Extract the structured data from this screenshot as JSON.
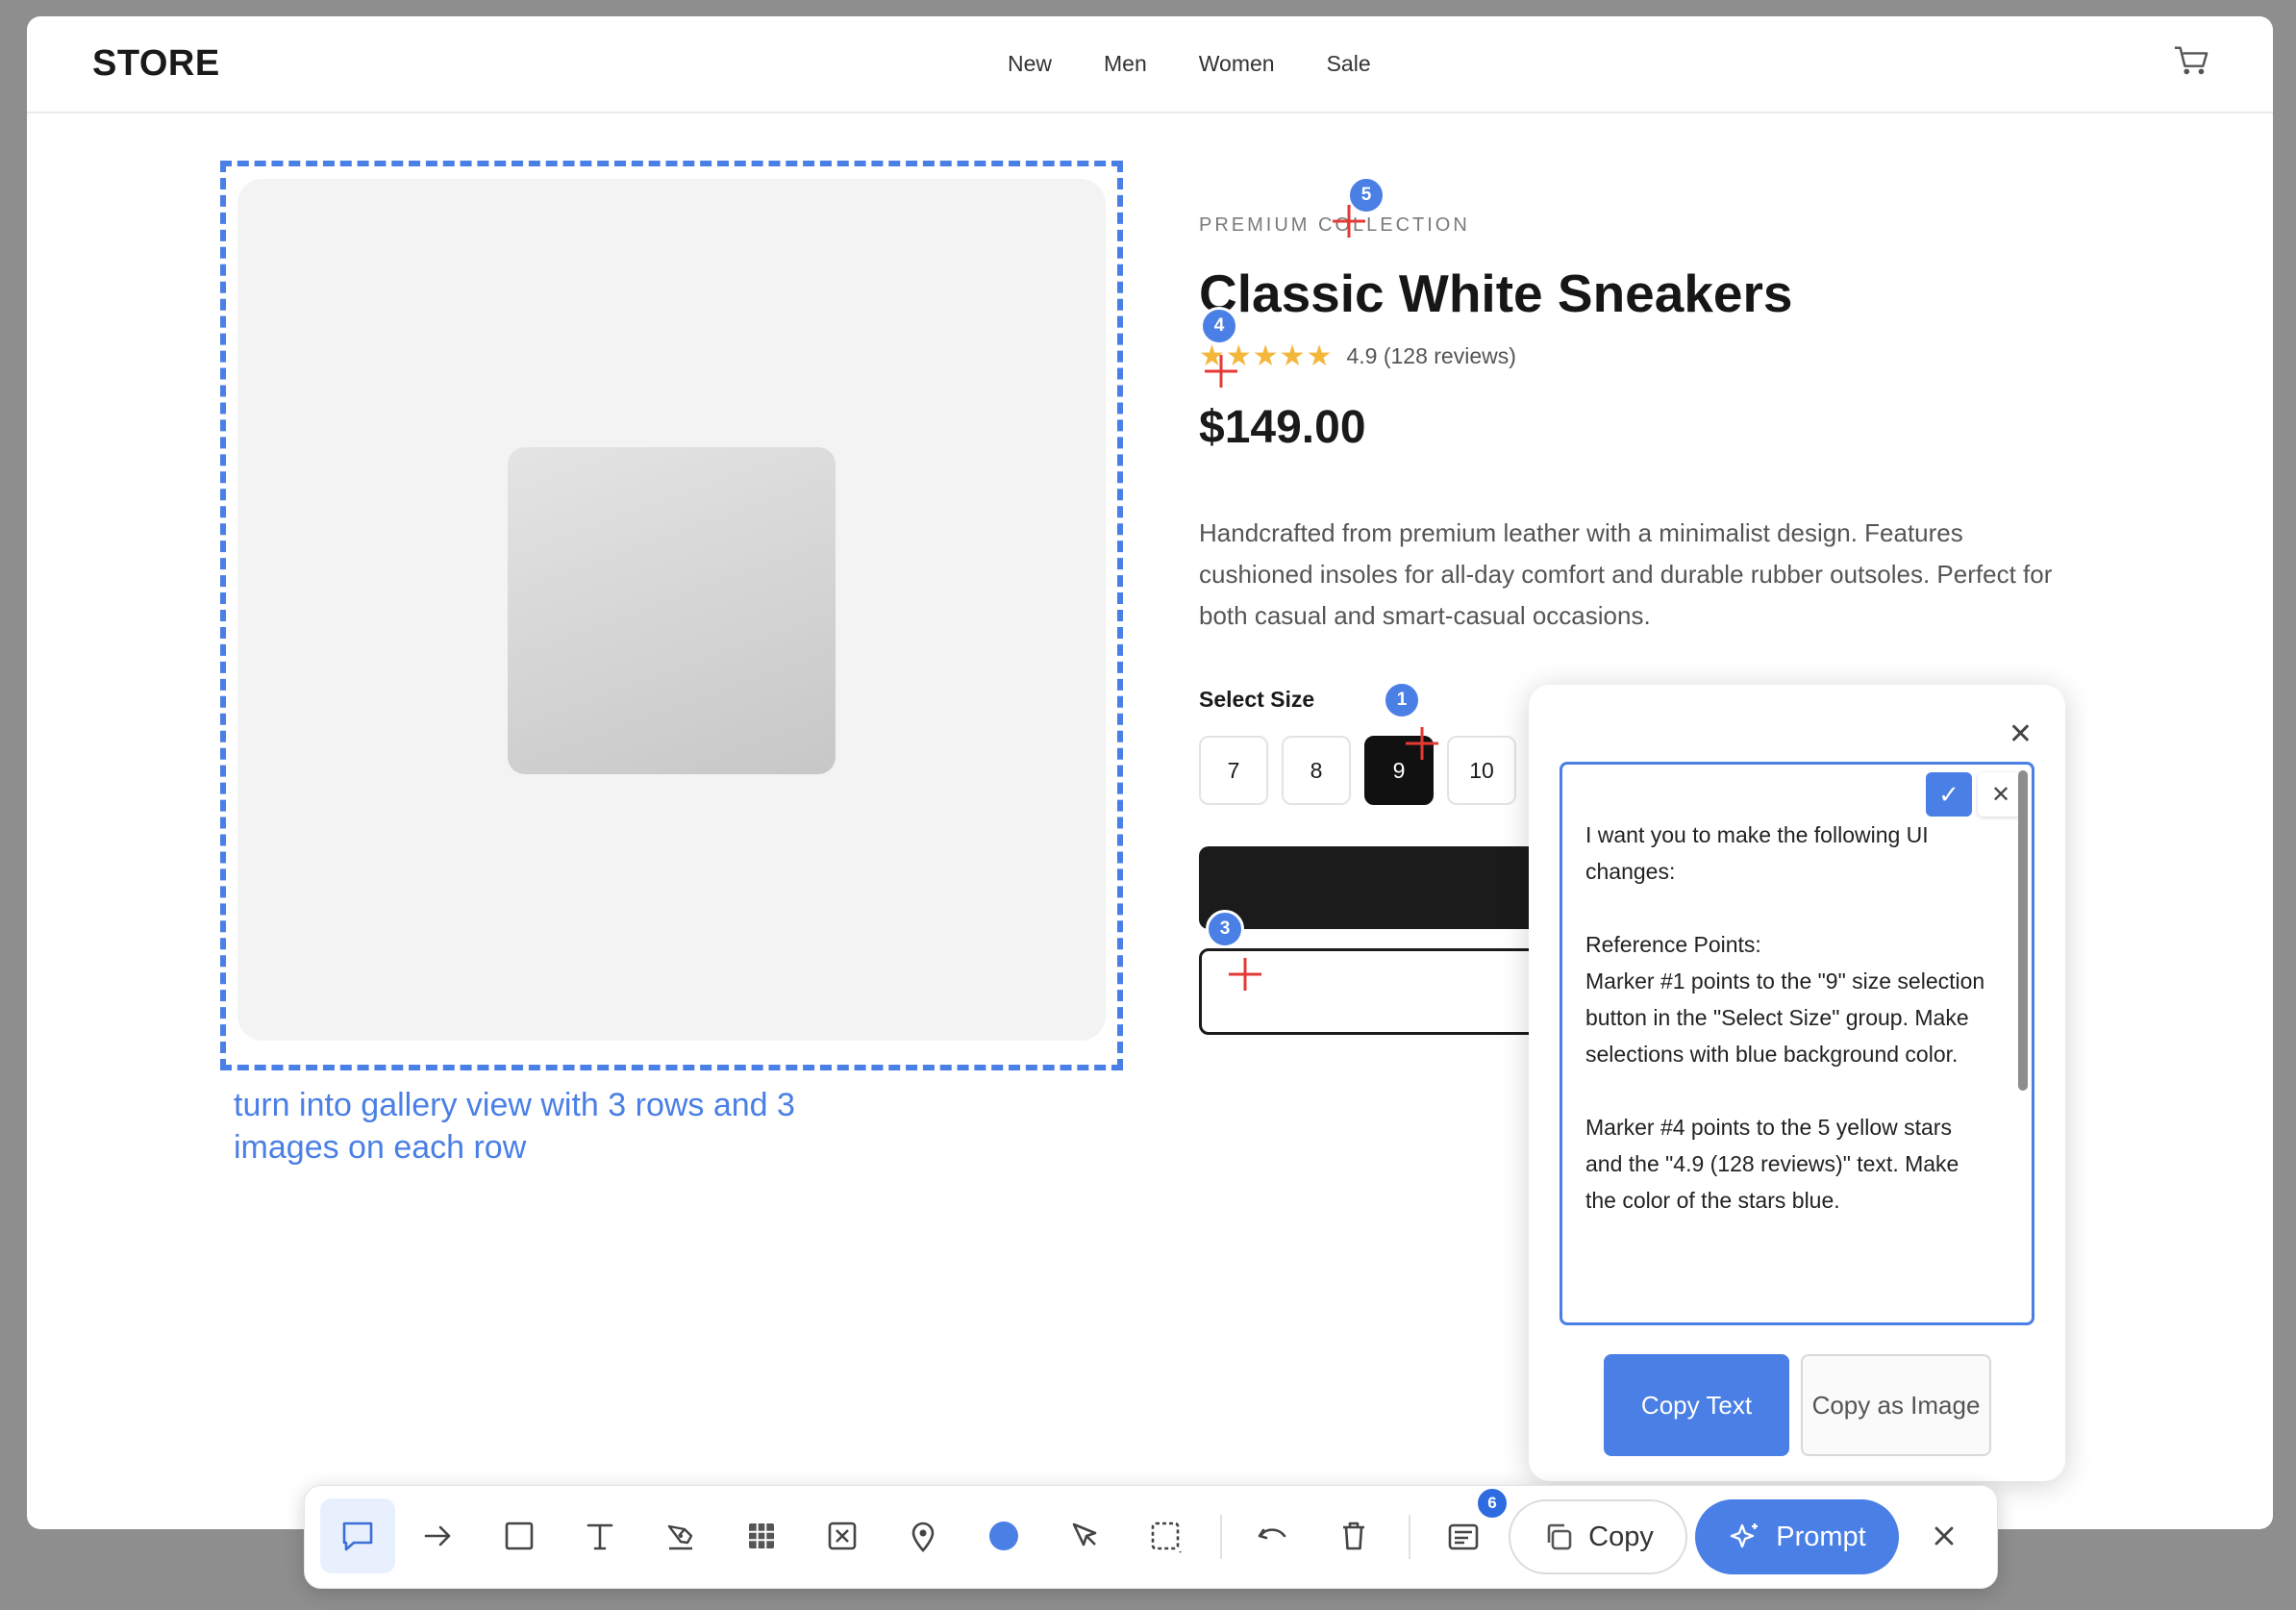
{
  "store": {
    "brand": "STORE",
    "nav": [
      "New",
      "Men",
      "Women",
      "Sale"
    ]
  },
  "annotation": {
    "note": "turn into gallery view with 3 rows and 3 images on each row"
  },
  "product": {
    "eyebrow": "PREMIUM COLLECTION",
    "title": "Classic White Sneakers",
    "stars": "★★★★★",
    "rating_text": "4.9 (128 reviews)",
    "price": "$149.00",
    "description": "Handcrafted from premium leather with a minimalist design. Features cushioned insoles for all-day comfort and durable rubber outsoles. Perfect for both casual and smart-casual occasions.",
    "size_label": "Select Size",
    "sizes": [
      "7",
      "8",
      "9",
      "10"
    ],
    "selected_size": "9"
  },
  "markers": [
    "1",
    "3",
    "4",
    "5"
  ],
  "panel": {
    "prompt_text": "I want you to make the following UI changes:\n\nReference Points:\nMarker #1 points to the \"9\" size selection button in the \"Select Size\" group. Make selections with blue background color.\n\nMarker #4 points to the 5 yellow stars and the \"4.9 (128 reviews)\" text. Make the color of the stars blue.",
    "copy_text_label": "Copy Text",
    "copy_image_label": "Copy as Image"
  },
  "toolbar": {
    "badge_count": "6",
    "copy_label": "Copy",
    "prompt_label": "Prompt",
    "accent_color": "#4a7fe5"
  }
}
